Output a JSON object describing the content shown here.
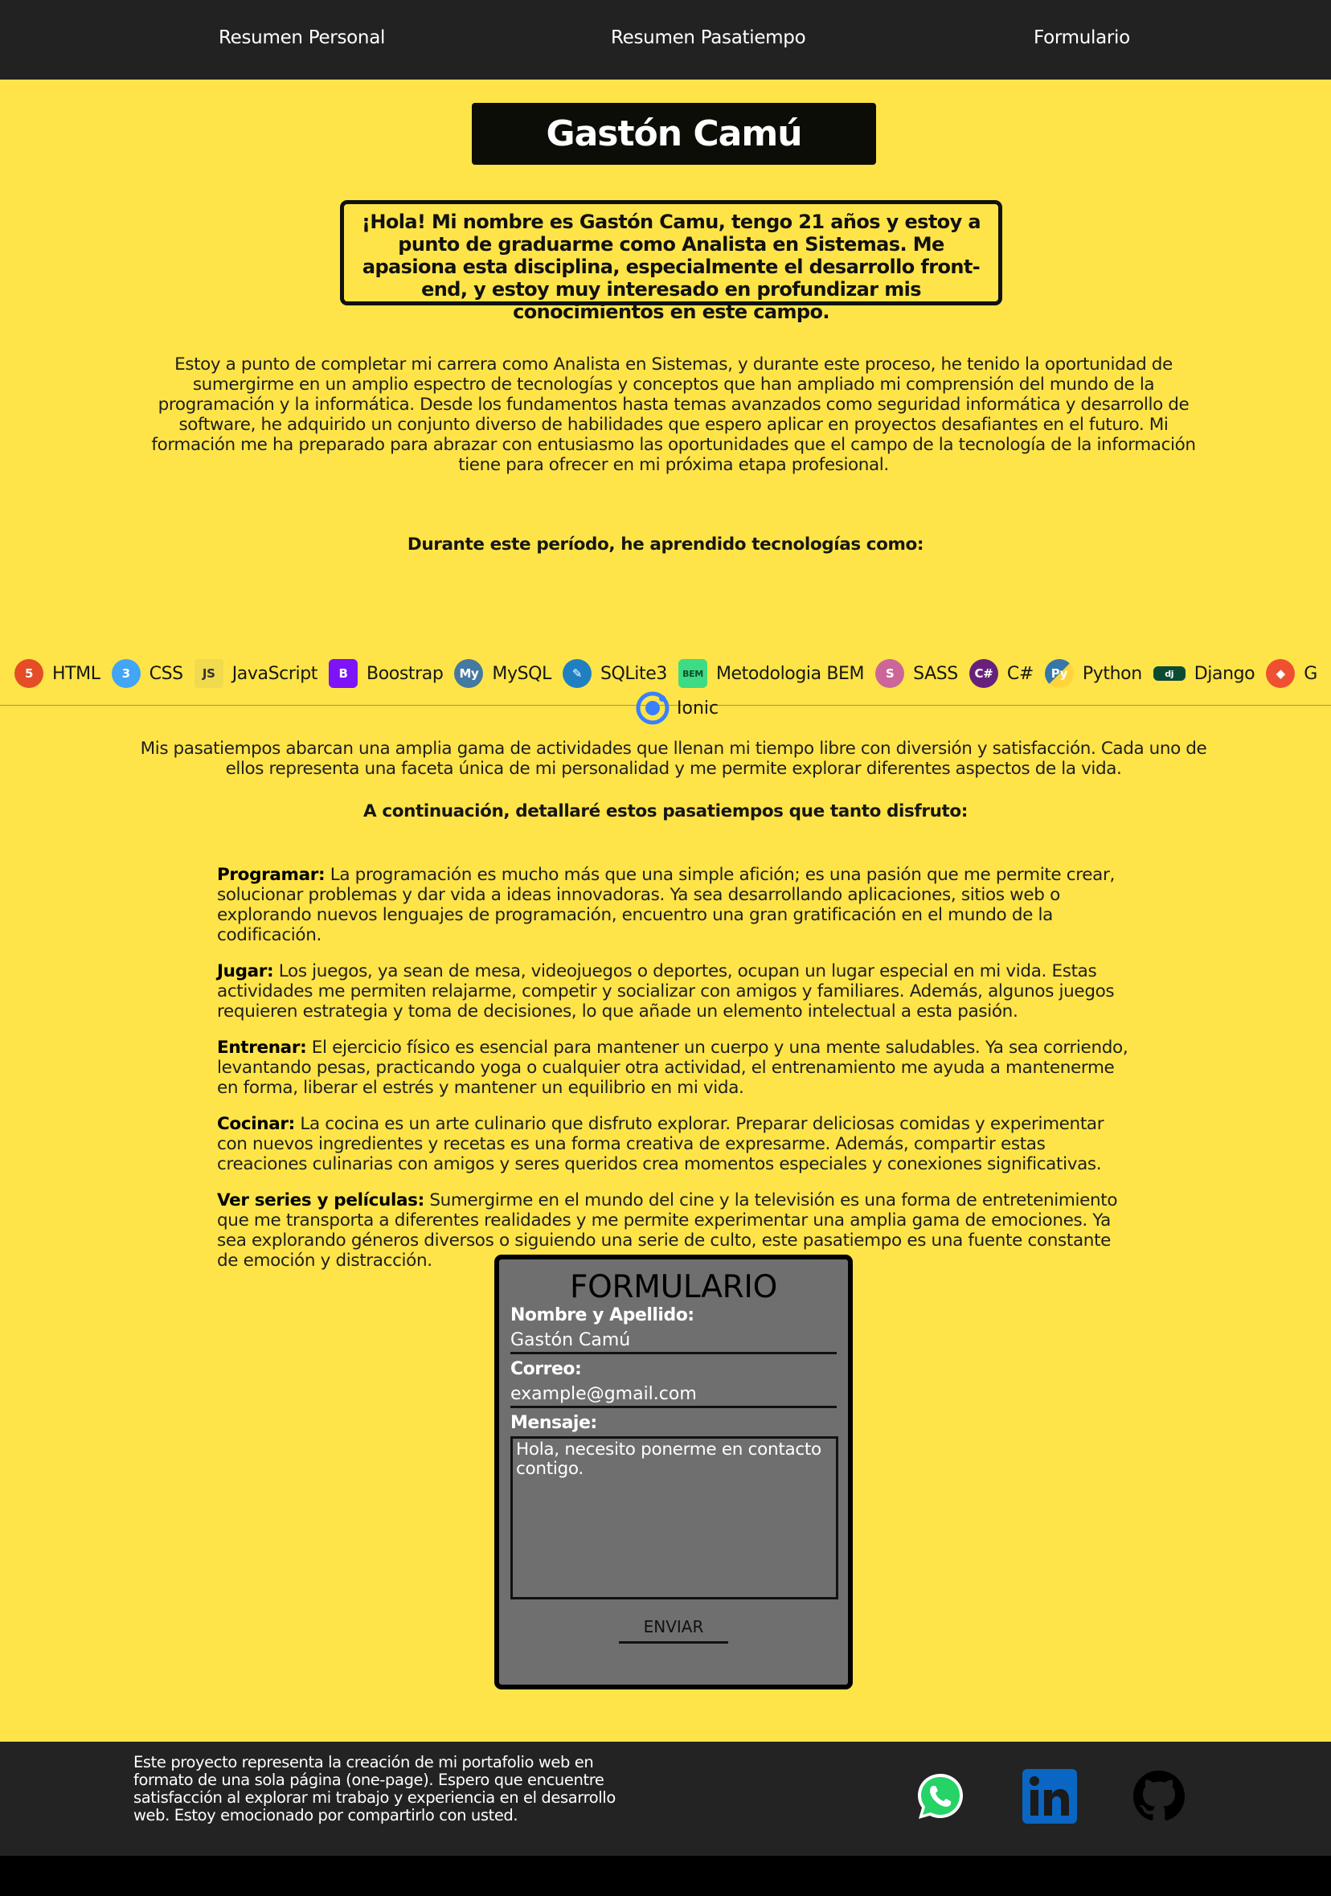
{
  "nav": {
    "items": [
      {
        "label": "Resumen Personal"
      },
      {
        "label": "Resumen Pasatiempo"
      },
      {
        "label": "Formulario"
      }
    ]
  },
  "header": {
    "name": "Gastón Camú",
    "intro": "¡Hola! Mi nombre es Gastón Camu, tengo 21 años y estoy a punto de graduarme como Analista en Sistemas. Me apasiona esta disciplina, especialmente el desarrollo front-end, y estoy muy interesado en profundizar mis conocimientos en este campo."
  },
  "career": {
    "text": "Estoy a punto de completar mi carrera como Analista en Sistemas, y durante este proceso, he tenido la oportunidad de sumergirme en un amplio espectro de tecnologías y conceptos que han ampliado mi comprensión del mundo de la programación y la informática. Desde los fundamentos hasta temas avanzados como seguridad informática y desarrollo de software, he adquirido un conjunto diverso de habilidades que espero aplicar en proyectos desafiantes en el futuro. Mi formación me ha preparado para abrazar con entusiasmo las oportunidades que el campo de la tecnología de la información tiene para ofrecer en mi próxima etapa profesional."
  },
  "technologies": {
    "title": "Durante este período, he aprendido tecnologías como:",
    "items": [
      {
        "label": "HTML",
        "icon": "html5-icon",
        "color": "#e44d26"
      },
      {
        "label": "CSS",
        "icon": "css3-icon",
        "color": "#42a5f5"
      },
      {
        "label": "JavaScript",
        "icon": "js-icon",
        "color": "#f0db4f"
      },
      {
        "label": "Boostrap",
        "icon": "bootstrap-icon",
        "color": "#7e13f8"
      },
      {
        "label": "MySQL",
        "icon": "mysql-icon",
        "color": "#4479a1"
      },
      {
        "label": "SQLite3",
        "icon": "sqlite-icon",
        "color": "#1f7fc1"
      },
      {
        "label": "Metodologia BEM",
        "icon": "bem-icon",
        "color": "#3ddc84"
      },
      {
        "label": "SASS",
        "icon": "sass-icon",
        "color": "#cc6699"
      },
      {
        "label": "C#",
        "icon": "csharp-icon",
        "color": "#68217a"
      },
      {
        "label": "Python",
        "icon": "python-icon",
        "color": "#3776ab"
      },
      {
        "label": "Django",
        "icon": "django-icon",
        "color": "#0c4b33"
      },
      {
        "label": "G",
        "icon": "git-icon",
        "color": "#f05032"
      }
    ],
    "extra": {
      "label": "Ionic",
      "icon": "ionic-icon",
      "color": "#3880ff"
    }
  },
  "hobbies": {
    "intro": "Mis pasatiempos abarcan una amplia gama de actividades que llenan mi tiempo libre con diversión y satisfacción. Cada uno de ellos representa una faceta única de mi personalidad y me permite explorar diferentes aspectos de la vida.",
    "title": "A continuación, detallaré estos pasatiempos que tanto disfruto:",
    "items": [
      {
        "name": "Programar:",
        "text": " La programación es mucho más que una simple afición; es una pasión que me permite crear, solucionar problemas y dar vida a ideas innovadoras. Ya sea desarrollando aplicaciones, sitios web o explorando nuevos lenguajes de programación, encuentro una gran gratificación en el mundo de la codificación."
      },
      {
        "name": "Jugar:",
        "text": " Los juegos, ya sean de mesa, videojuegos o deportes, ocupan un lugar especial en mi vida. Estas actividades me permiten relajarme, competir y socializar con amigos y familiares. Además, algunos juegos requieren estrategia y toma de decisiones, lo que añade un elemento intelectual a esta pasión."
      },
      {
        "name": "Entrenar:",
        "text": " El ejercicio físico es esencial para mantener un cuerpo y una mente saludables. Ya sea corriendo, levantando pesas, practicando yoga o cualquier otra actividad, el entrenamiento me ayuda a mantenerme en forma, liberar el estrés y mantener un equilibrio en mi vida."
      },
      {
        "name": "Cocinar:",
        "text": " La cocina es un arte culinario que disfruto explorar. Preparar deliciosas comidas y experimentar con nuevos ingredientes y recetas es una forma creativa de expresarme. Además, compartir estas creaciones culinarias con amigos y seres queridos crea momentos especiales y conexiones significativas."
      },
      {
        "name": "Ver series y películas:",
        "text": " Sumergirme en el mundo del cine y la televisión es una forma de entretenimiento que me transporta a diferentes realidades y me permite experimentar una amplia gama de emociones. Ya sea explorando géneros diversos o siguiendo una serie de culto, este pasatiempo es una fuente constante de emoción y distracción."
      }
    ]
  },
  "form": {
    "title": "FORMULARIO",
    "name_label": "Nombre y Apellido:",
    "name_value": "Gastón Camú",
    "email_label": "Correo:",
    "email_value": "example@gmail.com",
    "message_label": "Mensaje:",
    "message_value": "Hola, necesito ponerme en contacto contigo.",
    "submit_label": "ENVIAR"
  },
  "footer": {
    "text": "Este proyecto representa la creación de mi portafolio web en formato de una sola página (one-page). Espero que encuentre satisfacción al explorar mi trabajo y experiencia en el desarrollo web. Estoy emocionado por compartirlo con usted.",
    "social": [
      {
        "icon": "whatsapp-icon",
        "color": "#25d366"
      },
      {
        "icon": "linkedin-icon",
        "color": "#0a66c2"
      },
      {
        "icon": "github-icon",
        "color": "#000000"
      }
    ]
  },
  "colors": {
    "background": "#fee448",
    "nav": "#222222",
    "footer": "#232323",
    "form": "#6f6f6f"
  }
}
